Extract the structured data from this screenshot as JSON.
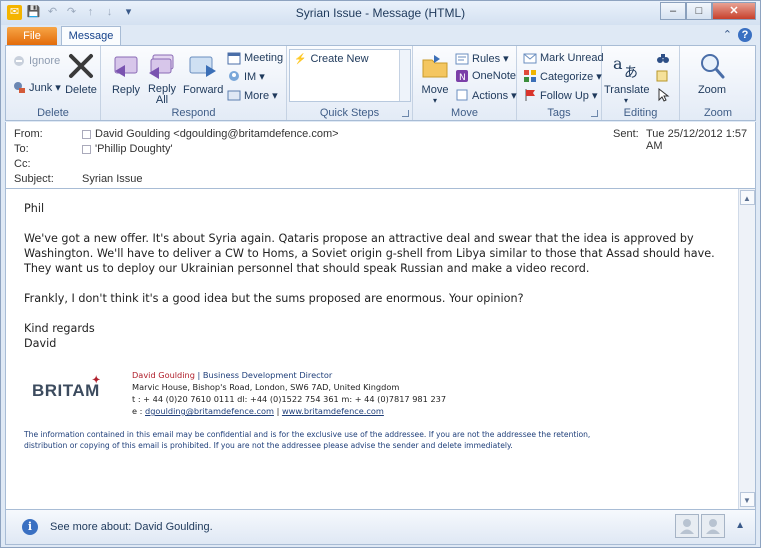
{
  "window": {
    "title": "Syrian Issue  -  Message (HTML)",
    "controls": {
      "minimize": "–",
      "maximize": "□",
      "close": "✕"
    }
  },
  "qat": {
    "save": "💾",
    "undo": "↶",
    "redo": "↷",
    "up": "↑",
    "down": "↓",
    "customize": "▾"
  },
  "tabs": {
    "file": "File",
    "message": "Message",
    "minimize_ribbon": "⌃",
    "help": "?"
  },
  "ribbon": {
    "delete_group": {
      "label": "Delete",
      "ignore": "Ignore",
      "junk": "Junk ▾",
      "delete": "Delete"
    },
    "respond_group": {
      "label": "Respond",
      "reply": "Reply",
      "reply_all": "Reply\nAll",
      "reply_all_line1": "Reply",
      "reply_all_line2": "All",
      "forward": "Forward",
      "meeting": "Meeting",
      "im": "IM ▾",
      "more": "More ▾"
    },
    "quick_steps_group": {
      "label": "Quick Steps",
      "create_new": "Create New"
    },
    "move_group": {
      "label": "Move",
      "move": "Move",
      "move_arrow": "▾",
      "rules": "Rules ▾",
      "onenote": "OneNote",
      "actions": "Actions ▾"
    },
    "tags_group": {
      "label": "Tags",
      "mark_unread": "Mark Unread",
      "categorize": "Categorize ▾",
      "follow_up": "Follow Up ▾"
    },
    "editing_group": {
      "label": "Editing",
      "translate": "Translate",
      "translate_arrow": "▾"
    },
    "zoom_group": {
      "label": "Zoom",
      "zoom": "Zoom"
    }
  },
  "header": {
    "from_label": "From:",
    "from_value": "David Goulding <dgoulding@britamdefence.com>",
    "to_label": "To:",
    "to_value": "'Phillip Doughty'",
    "cc_label": "Cc:",
    "subject_label": "Subject:",
    "subject_value": "Syrian Issue",
    "sent_label": "Sent:",
    "sent_value": "Tue 25/12/2012 1:57 AM"
  },
  "body": {
    "greeting": "Phil",
    "para1": "We've got a new offer.  It's about Syria again. Qataris propose an attractive deal and swear that the idea is approved by Washington. We'll have to deliver a CW to Homs, a Soviet origin g-shell from Libya similar to those that Assad should have. They want us to deploy our Ukrainian personnel that should speak Russian and make a video record.",
    "para2": "Frankly, I don't think it's a good idea but the sums proposed are enormous.  Your opinion?",
    "closing": "Kind regards",
    "signoff": "David"
  },
  "signature": {
    "logo_text": "BRITAM",
    "name": "David Goulding",
    "separator": "|",
    "title": "Business Development Director",
    "address": "Marvic House, Bishop's Road, London, SW6 7AD, United Kingdom",
    "phones": "t :  + 44 (0)20 7610 0111      dl: +44 (0)1522 754 361      m: + 44 (0)7817 981 237",
    "email_prefix": "e : ",
    "email": "dgoulding@britamdefence.com",
    "website": "www.britamdefence.com",
    "disclaimer": "The information contained in this email may be confidential and is for the exclusive use of the addressee. If you are not the addressee the retention, distribution or copying of this email is prohibited. If you are not the addressee please advise the sender and delete immediately."
  },
  "people_pane": {
    "info_glyph": "i",
    "text": "See more about: David Goulding.",
    "expand": "▲"
  },
  "colors": {
    "file_tab": "#e26b0a",
    "accent": "#1e395b",
    "britam_red": "#b0202c"
  }
}
